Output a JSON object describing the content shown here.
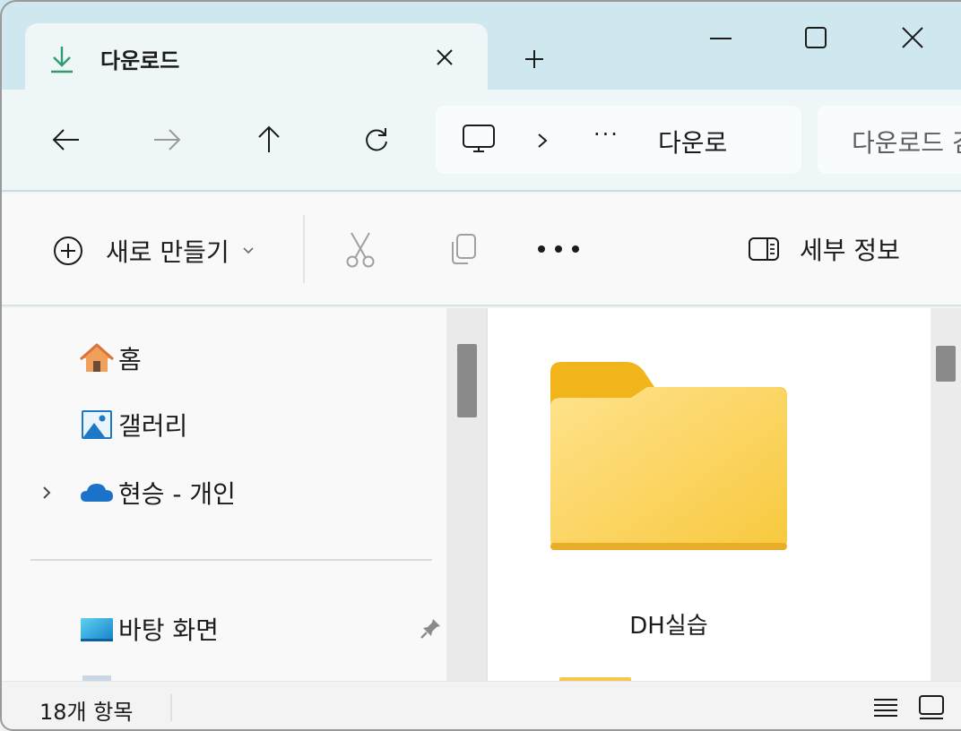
{
  "window": {
    "tab_title": "다운로드",
    "tab_icon": "download-arrow-icon",
    "new_tab_icon": "plus-icon",
    "controls": [
      "minimize-icon",
      "maximize-icon",
      "close-icon"
    ]
  },
  "nav": {
    "buttons": [
      "back-arrow-icon",
      "forward-arrow-icon",
      "up-arrow-icon",
      "refresh-icon"
    ],
    "address": {
      "root_icon": "this-pc-icon",
      "overflow": "···",
      "segment": "다운로"
    },
    "search_placeholder": "다운로드 검색"
  },
  "toolbar": {
    "new_label": "새로 만들기",
    "cut_icon": "scissors-icon",
    "copy_icon": "copy-icon",
    "more_icon": "more-options-icon",
    "details_label": "세부 정보"
  },
  "sidebar": {
    "items": [
      {
        "label": "홈",
        "icon": "home-icon"
      },
      {
        "label": "갤러리",
        "icon": "gallery-icon"
      },
      {
        "label": "현승 - 개인",
        "icon": "onedrive-cloud-icon",
        "expandable": true
      },
      {
        "label": "바탕 화면",
        "icon": "desktop-icon",
        "pinned": true
      }
    ]
  },
  "content": {
    "items": [
      {
        "name": "DH실습",
        "type": "folder"
      }
    ]
  },
  "status": {
    "item_count": "18개 항목"
  },
  "colors": {
    "titlebar_bg": "#cfe7ee",
    "toolbar_bg": "#f9f9f9",
    "folder_yellow": "#f7c948",
    "accent_green": "#2e9d6b",
    "onedrive_blue": "#1a73c9"
  }
}
